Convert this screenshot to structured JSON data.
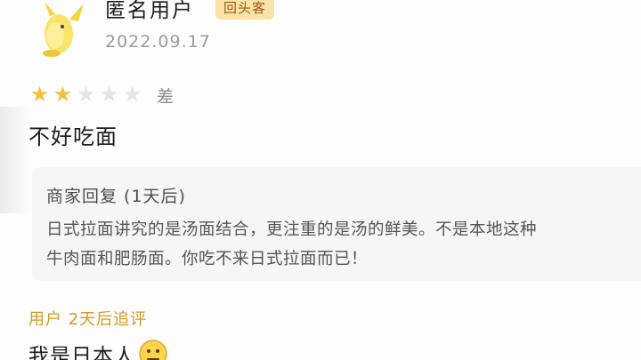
{
  "review": {
    "user_name": "匿名用户",
    "badge": "回头客",
    "date": "2022.09.17",
    "rating": {
      "stars_filled": 2,
      "stars_total": 5,
      "label": "差"
    },
    "text": "不好吃面"
  },
  "merchant_reply": {
    "title": "商家回复 (1天后)",
    "line1": "日式拉面讲究的是汤面结合，更注重的是汤的鲜美。不是本地这种",
    "line2": "牛肉面和肥肠面。你吃不来日式拉面而已！"
  },
  "followup": {
    "label": "用户 2天后追评",
    "text": "我是日本人"
  },
  "icons": {
    "avatar": "yellow-mascot-avatar",
    "star": "star-icon",
    "emoji": "awkward-face-emoji"
  },
  "colors": {
    "badge_bg": "#fbe2a6",
    "badge_text": "#9a5a16",
    "star_on": "#f2c23c",
    "star_off": "#e4e4e4",
    "followup_label": "#d49a1e",
    "reply_bg": "#f6f6f7"
  }
}
